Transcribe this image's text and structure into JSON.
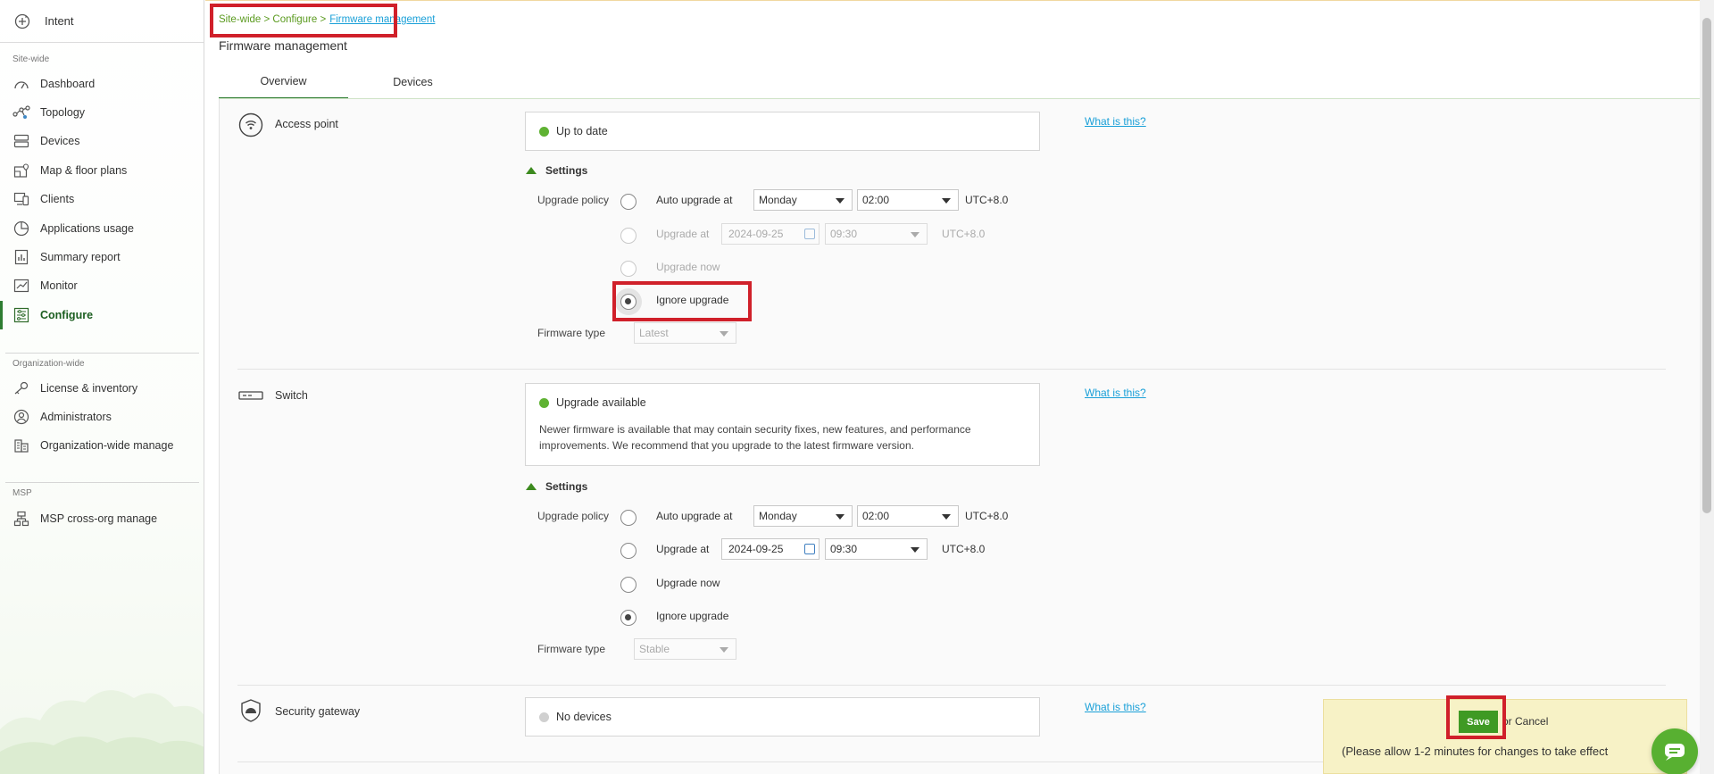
{
  "sidebar": {
    "intent_label": "Intent",
    "section_site": "Site-wide",
    "section_org": "Organization-wide",
    "section_msp": "MSP",
    "items": {
      "dashboard": "Dashboard",
      "topology": "Topology",
      "devices": "Devices",
      "map": "Map & floor plans",
      "clients": "Clients",
      "applications": "Applications usage",
      "summary": "Summary report",
      "monitor": "Monitor",
      "configure": "Configure",
      "license": "License & inventory",
      "administrators": "Administrators",
      "orgmanage": "Organization-wide manage",
      "msp": "MSP cross-org manage"
    }
  },
  "breadcrumb": {
    "path": "Site-wide > Configure >",
    "current": "Firmware management"
  },
  "page_title": "Firmware management",
  "tabs": [
    "Overview",
    "Devices"
  ],
  "what_is_this": "What is this?",
  "access_point": {
    "name": "Access point",
    "status": "Up to date",
    "settings_label": "Settings",
    "policy_label": "Upgrade policy",
    "auto_label": "Auto upgrade at",
    "auto_day": "Monday",
    "auto_time": "02:00",
    "tz": "UTC+8.0",
    "upgrade_at_label": "Upgrade at",
    "upgrade_date": "2024-09-25",
    "upgrade_time": "09:30",
    "now_label": "Upgrade now",
    "ignore_label": "Ignore upgrade",
    "fw_type_label": "Firmware type",
    "fw_type": "Latest"
  },
  "switch": {
    "name": "Switch",
    "status": "Upgrade available",
    "desc": "Newer firmware is available that may contain security fixes, new features, and performance improvements. We recommend that you upgrade to the latest firmware version.",
    "settings_label": "Settings",
    "policy_label": "Upgrade policy",
    "auto_label": "Auto upgrade at",
    "auto_day": "Monday",
    "auto_time": "02:00",
    "tz": "UTC+8.0",
    "upgrade_at_label": "Upgrade at",
    "upgrade_date": "2024-09-25",
    "upgrade_time": "09:30",
    "now_label": "Upgrade now",
    "ignore_label": "Ignore upgrade",
    "fw_type_label": "Firmware type",
    "fw_type": "Stable"
  },
  "gateway": {
    "name": "Security gateway",
    "status": "No devices"
  },
  "savebar": {
    "save_label": "Save",
    "or_label": "or",
    "cancel_label": "Cancel",
    "note": "(Please allow 1-2 minutes for changes to take effect"
  },
  "colors": {
    "accent": "#3f9a24",
    "link": "#1aa0d8",
    "highlight": "#d0202a"
  }
}
